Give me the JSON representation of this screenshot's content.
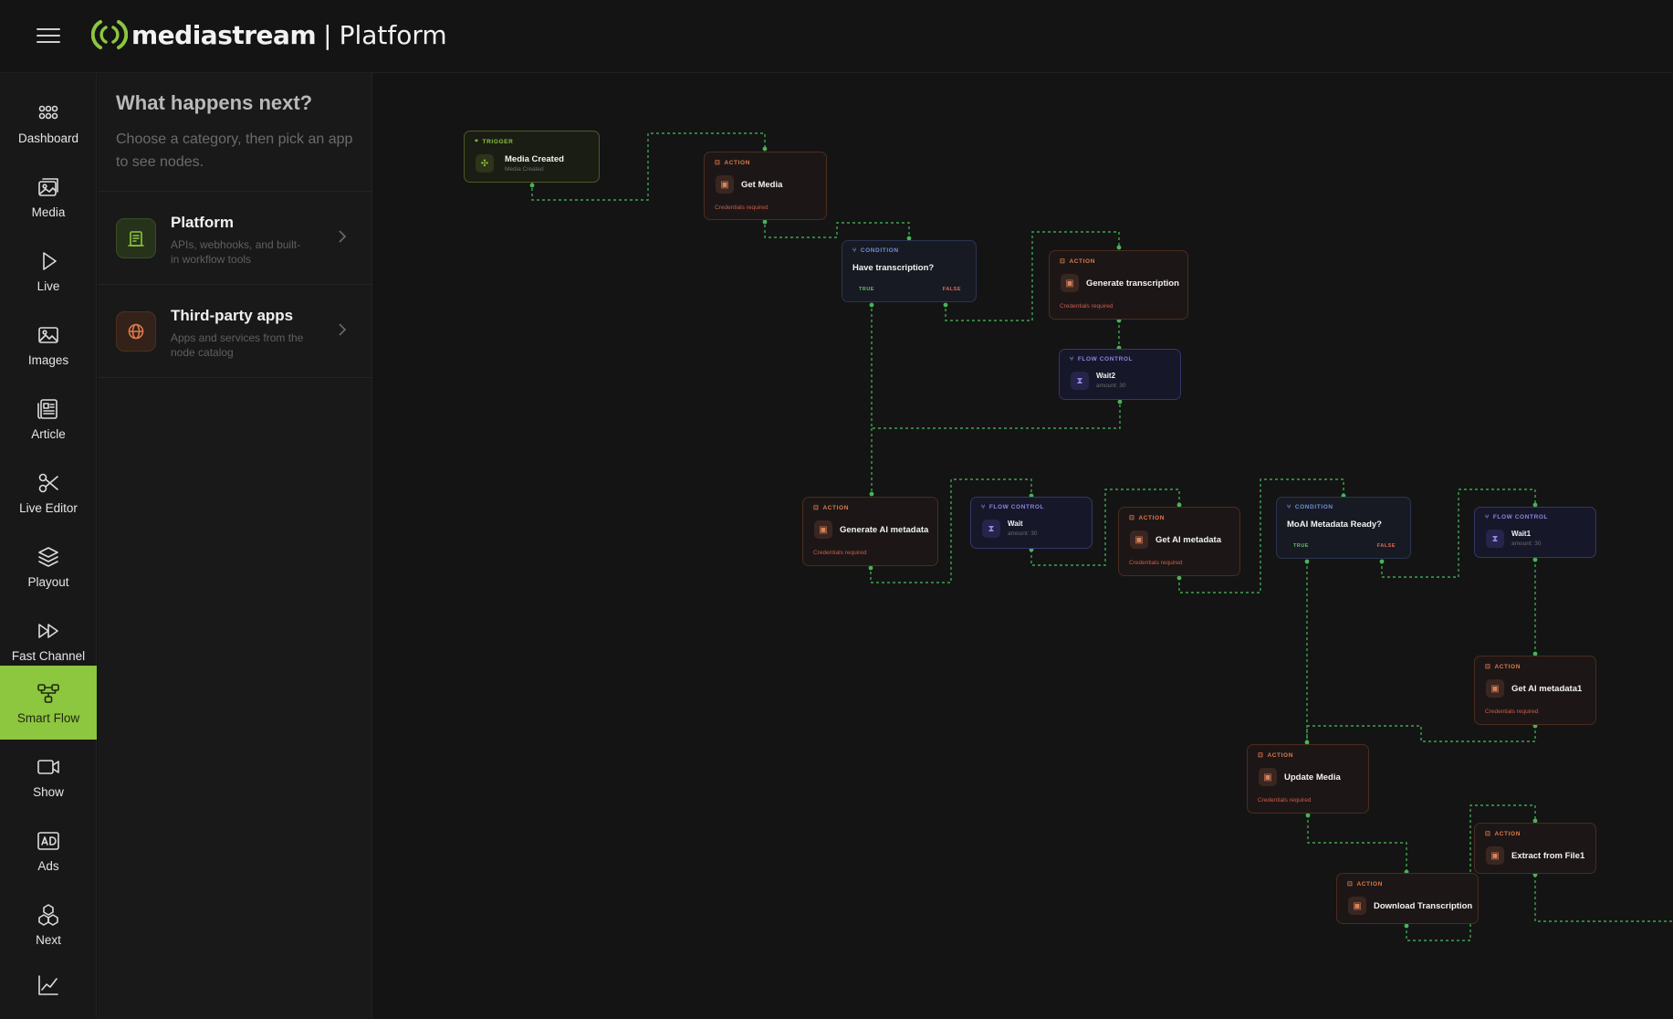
{
  "app": {
    "brand": "mediastream",
    "separator": "|",
    "product": "Platform",
    "accent_color": "#8dc63f"
  },
  "rail": {
    "items": [
      {
        "label": "Dashboard",
        "icon": "dashboard-icon"
      },
      {
        "label": "Media",
        "icon": "media-icon"
      },
      {
        "label": "Live",
        "icon": "live-icon"
      },
      {
        "label": "Images",
        "icon": "images-icon"
      },
      {
        "label": "Article",
        "icon": "article-icon"
      },
      {
        "label": "Live Editor",
        "icon": "scissors-icon"
      },
      {
        "label": "Playout",
        "icon": "layers-icon"
      },
      {
        "label": "Fast Channel",
        "icon": "fast-forward-icon"
      },
      {
        "label": "Smart Flow",
        "icon": "flow-icon",
        "active": true
      },
      {
        "label": "Show",
        "icon": "video-icon"
      },
      {
        "label": "Ads",
        "icon": "ad-icon"
      },
      {
        "label": "Next",
        "icon": "cubes-icon"
      },
      {
        "label": "",
        "icon": "analytics-icon"
      }
    ]
  },
  "panel": {
    "title": "What happens next?",
    "subtitle": "Choose a category, then pick an app to see nodes.",
    "categories": [
      {
        "name": "Platform",
        "description": "APIs, webhooks, and built-in workflow tools",
        "icon": "platform-icon",
        "color": "#8dc63f"
      },
      {
        "name": "Third-party apps",
        "description": "Apps and services from the node catalog",
        "icon": "globe-icon",
        "color": "#e07a4a"
      }
    ]
  },
  "nodes": {
    "media_created": {
      "type": "TRIGGER",
      "title": "Media Created",
      "sub": "Media Created"
    },
    "get_media": {
      "type": "ACTION",
      "title": "Get Media",
      "cred": "Credentials required"
    },
    "have_transcription": {
      "type": "CONDITION",
      "title": "Have transcription?",
      "true": "TRUE",
      "false": "FALSE"
    },
    "generate_transcription": {
      "type": "ACTION",
      "title": "Generate transcription",
      "cred": "Credentials required"
    },
    "wait2": {
      "type": "FLOW CONTROL",
      "title": "Wait2",
      "sub": "amount: 30"
    },
    "generate_ai_metadata": {
      "type": "ACTION",
      "title": "Generate AI metadata",
      "cred": "Credentials required"
    },
    "wait": {
      "type": "FLOW CONTROL",
      "title": "Wait",
      "sub": "amount: 30"
    },
    "get_ai_metadata": {
      "type": "ACTION",
      "title": "Get AI metadata",
      "cred": "Credentials required"
    },
    "moai_ready": {
      "type": "CONDITION",
      "title": "MoAI Metadata Ready?",
      "true": "TRUE",
      "false": "FALSE"
    },
    "wait1": {
      "type": "FLOW CONTROL",
      "title": "Wait1",
      "sub": "amount: 30"
    },
    "get_ai_metadata1": {
      "type": "ACTION",
      "title": "Get AI metadata1",
      "cred": "Credentials required"
    },
    "update_media": {
      "type": "ACTION",
      "title": "Update Media",
      "cred": "Credentials required"
    },
    "extract_from_file1": {
      "type": "ACTION",
      "title": "Extract from File1"
    },
    "download_transcription": {
      "type": "ACTION",
      "title": "Download Transcription"
    }
  }
}
